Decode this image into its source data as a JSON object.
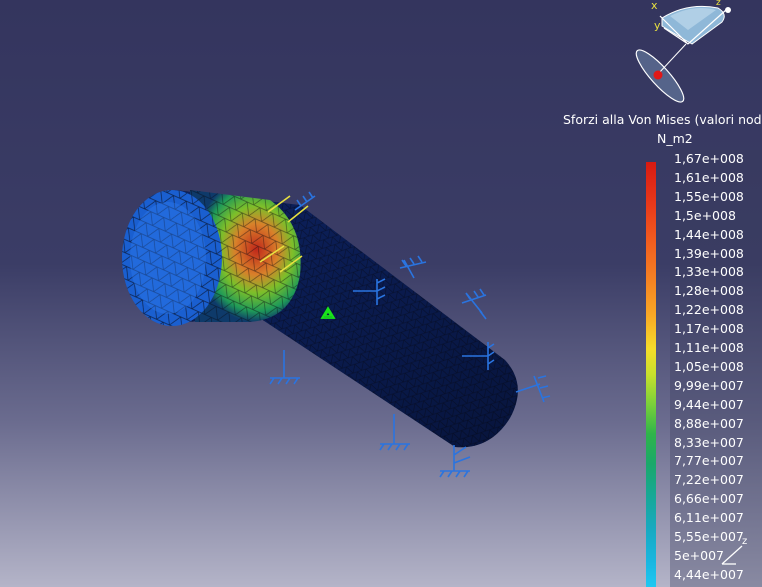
{
  "legend": {
    "title": "Sforzi alla Von Mises (valori noda",
    "unit": "N_m2",
    "values": [
      "1,67e+008",
      "1,61e+008",
      "1,55e+008",
      "1,5e+008",
      "1,44e+008",
      "1,39e+008",
      "1,33e+008",
      "1,28e+008",
      "1,22e+008",
      "1,17e+008",
      "1,11e+008",
      "1,05e+008",
      "9,99e+007",
      "9,44e+007",
      "8,88e+007",
      "8,33e+007",
      "7,77e+007",
      "7,22e+007",
      "6,66e+007",
      "6,11e+007",
      "5,55e+007",
      "5e+007",
      "4,44e+007"
    ]
  },
  "compass": {
    "x_label": "x",
    "y_label": "y",
    "z_label": "z"
  },
  "corner_axis": {
    "z_label": "z"
  },
  "colors": {
    "mesh_line": "#0a0a14",
    "part_body": "#0a1a4a",
    "restraint": "#2a74e0",
    "load_arrow": "#e8e040",
    "anchor": "#19e619"
  }
}
